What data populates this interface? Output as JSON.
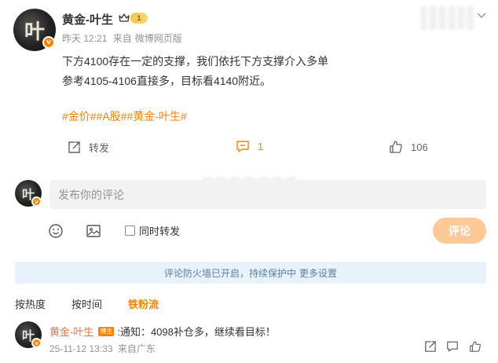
{
  "post": {
    "author": "黄金-叶生",
    "level_badge": "1",
    "avatar_glyph": "叶",
    "verified_mark": "v",
    "time": "昨天 12:21",
    "source_prefix": "来自",
    "source": "微博网页版",
    "lines": [
      "下方4100存在一定的支撑，我们依托下方支撑介入多单",
      "参考4105-4106直接多，目标看4140附近。"
    ],
    "tags": "#金价##A股##黄金-叶生#",
    "actions": {
      "repost_label": "转发",
      "comment_count": "1",
      "like_count": "106"
    }
  },
  "composer": {
    "placeholder": "发布你的评论",
    "repost_option": "同时转发",
    "submit_label": "评论"
  },
  "firewall": {
    "text": "评论防火墙已开启，持续保护中",
    "link": "更多设置"
  },
  "sort_tabs": {
    "hot": "按热度",
    "time": "按时间",
    "fans": "铁粉流"
  },
  "comment": {
    "author": "黄金-叶生",
    "role_badge": "博主",
    "text": ":通知：4098补仓多，继续看目标！",
    "time": "25-11-12 13:33",
    "location": "来自广东"
  },
  "colors": {
    "accent": "#ff8200",
    "submit_disabled": "#ffc897",
    "firewall_bg": "#e8f2fb",
    "firewall_text": "#5a7fa6"
  }
}
